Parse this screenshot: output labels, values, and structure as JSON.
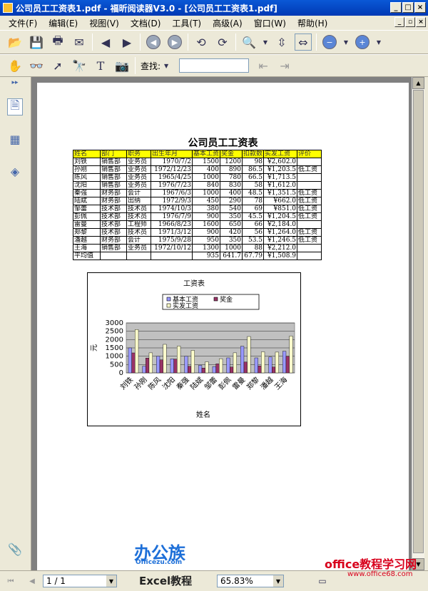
{
  "window": {
    "title": "公司员工工资表1.pdf - 福昕阅读器V3.0 - [公司员工工资表1.pdf]"
  },
  "menu": [
    "文件(F)",
    "编辑(E)",
    "视图(V)",
    "文档(D)",
    "工具(T)",
    "高级(A)",
    "窗口(W)",
    "帮助(H)"
  ],
  "find": {
    "label": "查找:"
  },
  "status": {
    "page": "1 / 1",
    "zoom": "65.83%"
  },
  "document": {
    "title": "公司员工工资表",
    "headers": [
      "姓名",
      "部门",
      "职务",
      "出生年月",
      "基本工资",
      "奖金",
      "扣款数",
      "实发工资",
      "评价"
    ],
    "rows": [
      [
        "刘铁",
        "销售部",
        "业务员",
        "1970/7/2",
        "1500",
        "1200",
        "98",
        "¥2,602.0",
        ""
      ],
      [
        "孙刚",
        "销售部",
        "业务员",
        "1972/12/23",
        "400",
        "890",
        "86.5",
        "¥1,203.5",
        "低工资"
      ],
      [
        "陈风",
        "销售部",
        "业务员",
        "1965/4/25",
        "1000",
        "780",
        "66.5",
        "¥1,713.5",
        ""
      ],
      [
        "沈阳",
        "销售部",
        "业务员",
        "1976/7/23",
        "840",
        "830",
        "58",
        "¥1,612.0",
        ""
      ],
      [
        "秦强",
        "财务部",
        "会计",
        "1967/6/3",
        "1000",
        "400",
        "48.5",
        "¥1,351.5",
        "低工资"
      ],
      [
        "陆斌",
        "财务部",
        "出纳",
        "1972/9/3",
        "450",
        "290",
        "78",
        "¥662.0",
        "低工资"
      ],
      [
        "邹蕾",
        "技术部",
        "技术员",
        "1974/10/3",
        "380",
        "540",
        "69",
        "¥851.0",
        "低工资"
      ],
      [
        "彭佩",
        "技术部",
        "技术员",
        "1976/7/9",
        "900",
        "350",
        "45.5",
        "¥1,204.5",
        "低工资"
      ],
      [
        "雷曼",
        "技术部",
        "工程师",
        "1966/8/23",
        "1600",
        "650",
        "66",
        "¥2,184.0",
        ""
      ],
      [
        "郑黎",
        "技术部",
        "技术员",
        "1971/3/12",
        "900",
        "420",
        "56",
        "¥1,264.0",
        "低工资"
      ],
      [
        "潘越",
        "财务部",
        "会计",
        "1975/9/28",
        "950",
        "350",
        "53.5",
        "¥1,246.5",
        "低工资"
      ],
      [
        "王海",
        "销售部",
        "业务员",
        "1972/10/12",
        "1300",
        "1000",
        "88",
        "¥2,212.0",
        ""
      ]
    ],
    "average": [
      "平均值",
      "",
      "",
      "",
      "935",
      "641.7",
      "67.79",
      "¥1,508.9",
      ""
    ]
  },
  "chart_data": {
    "type": "bar",
    "title": "工资表",
    "xlabel": "姓名",
    "ylabel": "元",
    "ylim": [
      0,
      3000
    ],
    "yticks": [
      "3000",
      "2500",
      "2000",
      "1500",
      "1000",
      "500",
      "0"
    ],
    "legend_position": "top",
    "categories": [
      "刘铁",
      "孙刚",
      "陈风",
      "沈阳",
      "秦强",
      "陆斌",
      "邹蕾",
      "彭佩",
      "雷曼",
      "郑黎",
      "潘越",
      "王海"
    ],
    "series": [
      {
        "name": "基本工资",
        "color": "#9999ff",
        "values": [
          1500,
          400,
          1000,
          840,
          1000,
          450,
          380,
          900,
          1600,
          900,
          950,
          1300
        ]
      },
      {
        "name": "奖金",
        "color": "#993366",
        "values": [
          1200,
          890,
          780,
          830,
          400,
          290,
          540,
          350,
          650,
          420,
          350,
          1000
        ]
      },
      {
        "name": "实发工资",
        "color": "#ffffcc",
        "values": [
          2602,
          1203.5,
          1713.5,
          1612,
          1351.5,
          662,
          851,
          1204.5,
          2184,
          1264,
          1246.5,
          2212
        ]
      }
    ]
  },
  "watermarks": {
    "logo": "办公族",
    "logo_sub": "Officezu.com",
    "excel": "Excel教程",
    "site_cn": "office教程学习网",
    "site_url": "www.office68.com"
  }
}
